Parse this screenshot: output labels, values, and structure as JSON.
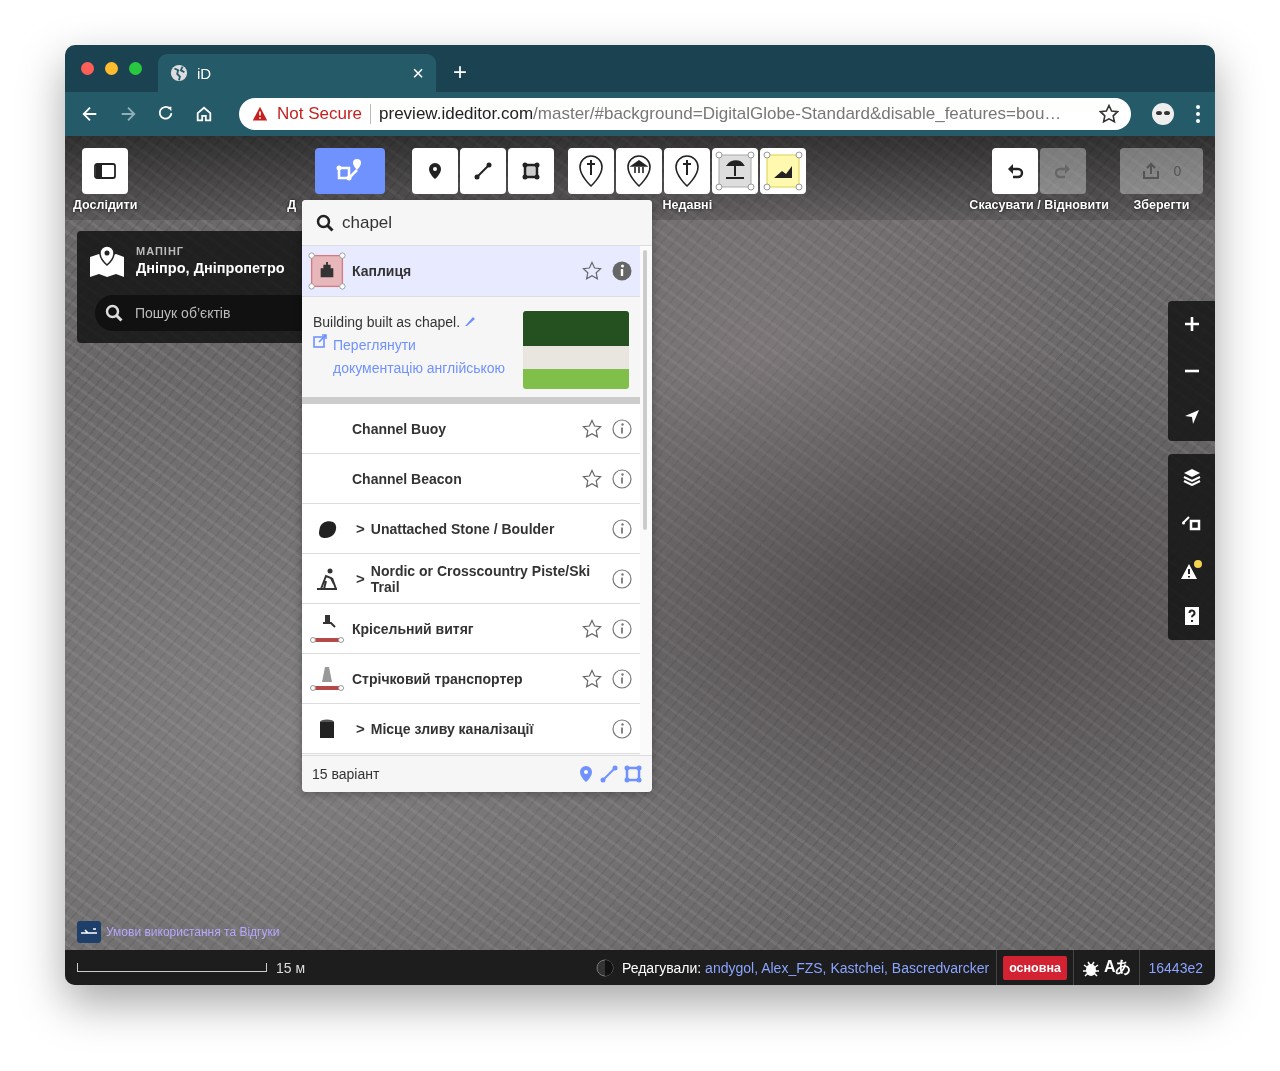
{
  "browser": {
    "tab_title": "iD",
    "tab_close": "×",
    "new_tab": "+",
    "security": "Not Secure",
    "url_host": "preview.ideditor.com",
    "url_path": "/master/#background=DigitalGlobe-Standard&disable_features=bou…"
  },
  "toolbar": {
    "explore_label": "Дослідити",
    "add_label": "Д",
    "add_selected": true,
    "recent_label": "Недавні",
    "undo_redo_label": "Скасувати / Відновити",
    "undo_disabled": false,
    "redo_disabled": true,
    "save_label": "Зберегти",
    "save_count": "0",
    "save_disabled": true
  },
  "location_panel": {
    "caption": "МАПІНГ",
    "title": "Дніпро, Дніпропетро",
    "search_placeholder": "Пошук об’єктів"
  },
  "preset_search": {
    "value": "chapel",
    "description": "Building built as chapel.",
    "doc_link": "Переглянути документацію англійською",
    "count": "15 варіант",
    "results": [
      {
        "kind": "preset",
        "label": "Каплиця",
        "selected": true
      },
      {
        "kind": "preset",
        "label": "Channel Buoy",
        "selected": false
      },
      {
        "kind": "preset",
        "label": "Channel Beacon",
        "selected": false
      },
      {
        "kind": "category",
        "chevron": ">",
        "label": "Unattached Stone / Boulder",
        "selected": false
      },
      {
        "kind": "category",
        "chevron": ">",
        "label": "Nordic or Crosscountry Piste/Ski Trail",
        "selected": false
      },
      {
        "kind": "preset",
        "label": "Крісельний витяг",
        "selected": false
      },
      {
        "kind": "preset",
        "label": "Стрічковий транспортер",
        "selected": false
      },
      {
        "kind": "category",
        "chevron": ">",
        "label": "Місце зливу каналізації",
        "selected": false
      }
    ]
  },
  "attribution": "Умови використання та Відгуки",
  "footer": {
    "scale": "15 м",
    "edited_by_label": "Редагували:",
    "editors": "andygol, Alex_FZS, Kastchei, Bascredvarcker",
    "branch": "основна",
    "translate": "Aあ",
    "version": "16443e2"
  }
}
